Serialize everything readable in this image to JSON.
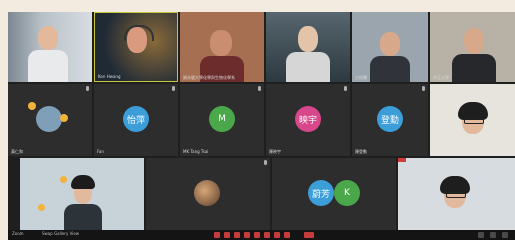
{
  "tiles": [
    {
      "id": "t1",
      "name": "",
      "avatar": null
    },
    {
      "id": "t2",
      "name": "Ken Hwang",
      "avatar": null
    },
    {
      "id": "t3",
      "name": "謝永健大學化學與生物化學系",
      "avatar": null
    },
    {
      "id": "t4",
      "name": "",
      "avatar": null
    },
    {
      "id": "t5",
      "name": "方振騰",
      "avatar": null
    },
    {
      "id": "t6",
      "name": "中正大學",
      "avatar": null
    },
    {
      "id": "t7",
      "name": "黃仁和",
      "avatar": null
    },
    {
      "id": "t8",
      "name": "Fan",
      "avatar": null
    },
    {
      "id": "t9",
      "name": "",
      "avatar": {
        "text": "怡萍",
        "color": "#3b9ed8"
      }
    },
    {
      "id": "t10",
      "name": "MK Tang Tsai",
      "avatar": {
        "text": "M",
        "color": "#4aa84a"
      }
    },
    {
      "id": "t11",
      "name": "陳映宇",
      "avatar": {
        "text": "映宇",
        "color": "#d8468b"
      }
    },
    {
      "id": "t12",
      "name": "陳登勳",
      "avatar": {
        "text": "登勳",
        "color": "#3b9ed8"
      }
    },
    {
      "id": "t13",
      "name": "",
      "avatar": null
    },
    {
      "id": "t14",
      "name": "",
      "avatar": null
    },
    {
      "id": "t15",
      "name": "",
      "avatar": null
    },
    {
      "id": "t16",
      "name": "",
      "avatar": {
        "text": "蔚芳",
        "color": "#3b9ed8"
      }
    },
    {
      "id": "t16b",
      "name": "",
      "avatar": {
        "text": "K",
        "color": "#4aa84a"
      }
    },
    {
      "id": "t17",
      "name": "",
      "avatar": null
    }
  ],
  "toolbar": {
    "left_label_1": "Zoom",
    "left_label_2": "Swap Gallery View"
  },
  "colors": {
    "window_bg": "#1f1f1f",
    "tile_bg": "#2d2d2d",
    "control_red": "#c63c3c"
  }
}
